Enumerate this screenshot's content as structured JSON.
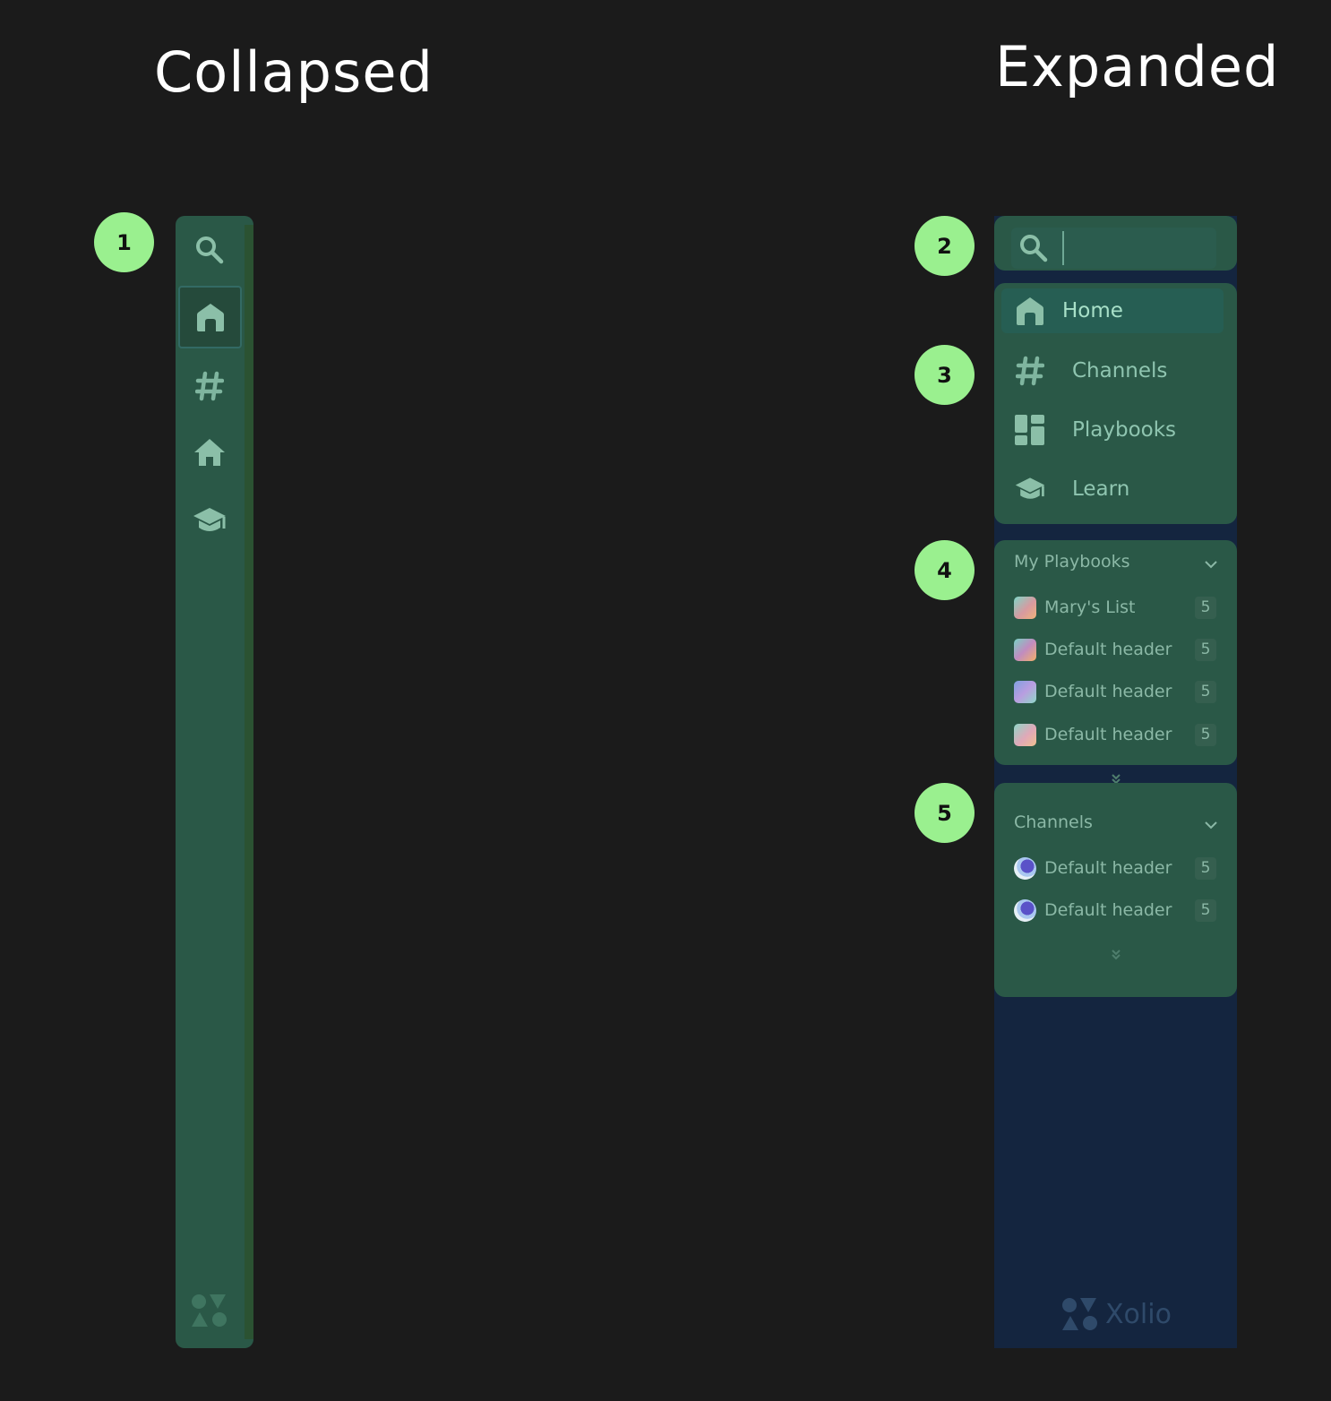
{
  "titles": {
    "collapsed": "Collapsed",
    "expanded": "Expanded"
  },
  "markers": [
    "1",
    "2",
    "3",
    "4",
    "5"
  ],
  "collapsed_rail": {
    "icons": [
      "search-icon",
      "home-icon",
      "hash-icon",
      "house-icon",
      "graduation-cap-icon"
    ],
    "active": "home-icon",
    "logo": "xolio-mark-icon"
  },
  "expanded": {
    "search": {
      "placeholder": ""
    },
    "nav": [
      {
        "label": "Home",
        "icon": "home-icon",
        "active": true
      },
      {
        "label": "Channels",
        "icon": "hash-icon",
        "active": false
      },
      {
        "label": "Playbooks",
        "icon": "grid-icon",
        "active": false
      },
      {
        "label": "Learn",
        "icon": "graduation-cap-icon",
        "active": false
      }
    ],
    "my_playbooks": {
      "title": "My Playbooks",
      "items": [
        {
          "label": "Mary's List",
          "count": "5"
        },
        {
          "label": "Default header",
          "count": "5"
        },
        {
          "label": "Default header",
          "count": "5"
        },
        {
          "label": "Default header",
          "count": "5"
        }
      ]
    },
    "channels": {
      "title": "Channels",
      "items": [
        {
          "label": "Default header",
          "count": "5"
        },
        {
          "label": "Default header",
          "count": "5"
        }
      ]
    },
    "logo": {
      "text": "Xolio"
    }
  },
  "colors": {
    "background": "#1b1b1b",
    "panel": "#2a5847",
    "sidebar_bottom": "#14253f",
    "marker": "#9af08f"
  }
}
